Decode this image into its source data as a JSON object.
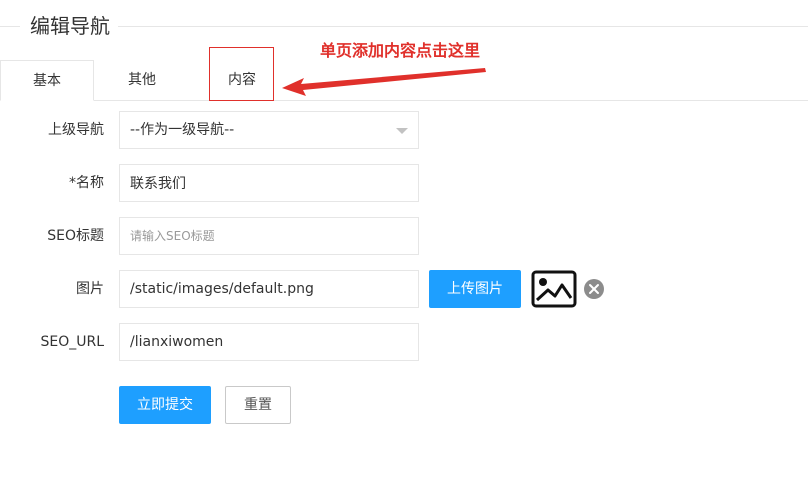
{
  "page": {
    "title": "编辑导航"
  },
  "tabs": [
    {
      "label": "基本",
      "active": true
    },
    {
      "label": "其他",
      "active": false
    },
    {
      "label": "内容",
      "active": false
    }
  ],
  "annotation": {
    "text": "单页添加内容点击这里",
    "color": "#e0302b"
  },
  "form": {
    "parent": {
      "label": "上级导航",
      "value": "--作为一级导航--"
    },
    "name": {
      "label": "*名称",
      "value": "联系我们"
    },
    "seo_title": {
      "label": "SEO标题",
      "value": "",
      "placeholder": "请输入SEO标题"
    },
    "image": {
      "label": "图片",
      "value": "/static/images/default.png",
      "upload_label": "上传图片"
    },
    "seo_url": {
      "label": "SEO_URL",
      "value": "/lianxiwomen"
    },
    "submit_label": "立即提交",
    "reset_label": "重置"
  },
  "colors": {
    "primary": "#1e9fff",
    "border": "#e6e6e6",
    "annotation": "#e0302b"
  },
  "icons": {
    "preview": "image-icon",
    "remove": "close-circle-icon",
    "select": "caret-down-icon"
  }
}
